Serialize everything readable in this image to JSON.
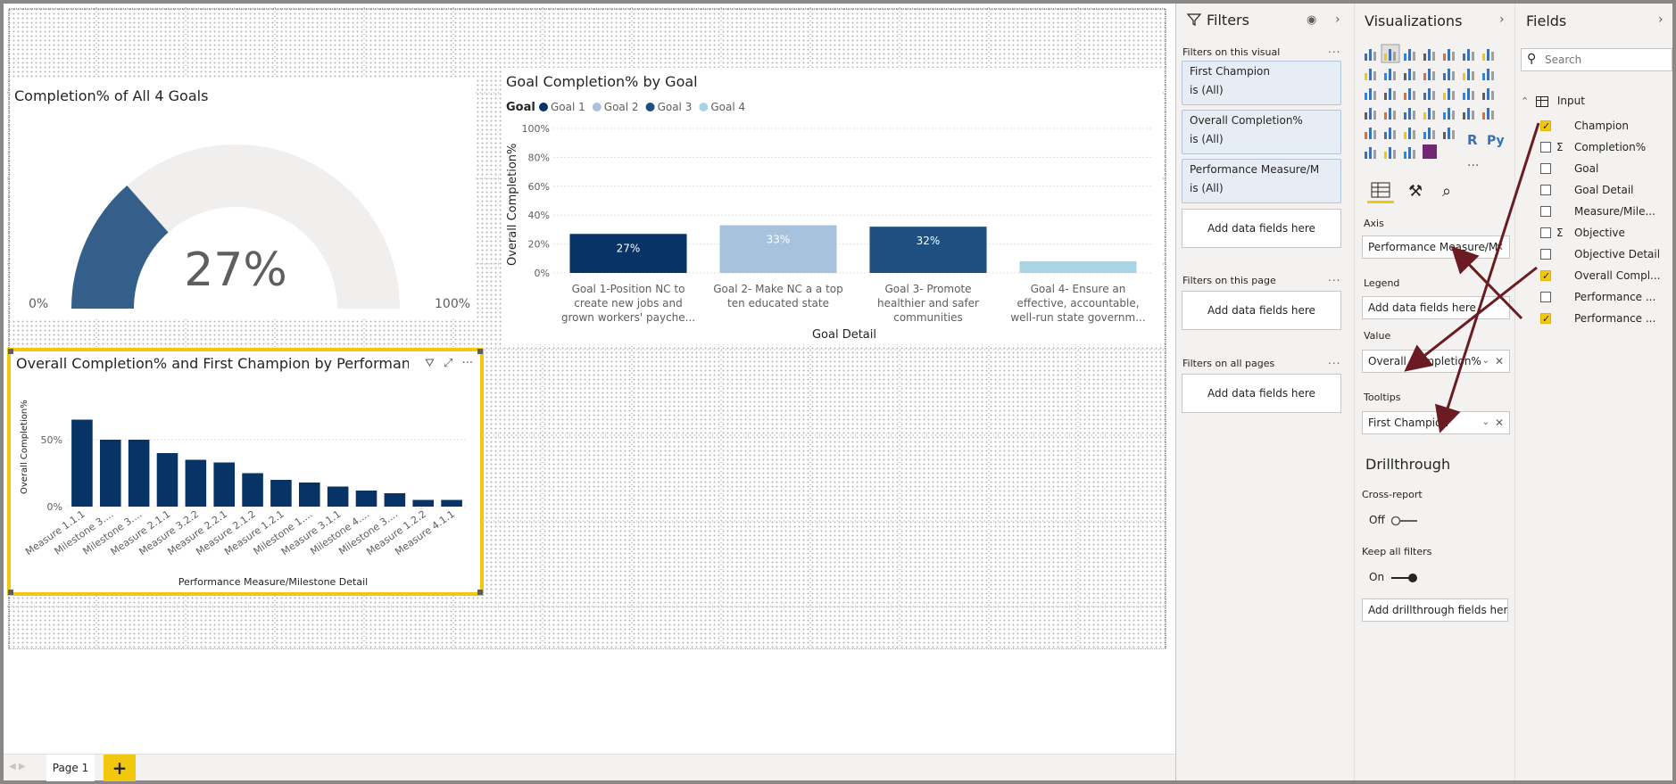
{
  "report": {
    "page_tab": "Page 1",
    "add_page": "+"
  },
  "gauge": {
    "title": "Completion% of All 4 Goals",
    "value_label": "27%",
    "min_label": "0%",
    "max_label": "100%",
    "value_fraction": 0.27,
    "fill_color": "#335f8a",
    "track_color": "#f0efee"
  },
  "goal_chart": {
    "title": "Goal Completion% by Goal",
    "legend_title": "Goal",
    "ylabel": "Overall Completion%",
    "xlabel": "Goal Detail",
    "yticks": [
      "100%",
      "80%",
      "60%",
      "40%",
      "20%",
      "0%"
    ]
  },
  "perf_chart": {
    "title": "Overall Completion% and First Champion by Performance Measure/Milestone Detail",
    "ylabel": "Overall Completion%",
    "xlabel": "Performance Measure/Milestone Detail",
    "yticks": [
      "50%",
      "0%"
    ]
  },
  "chart_data": [
    {
      "type": "bar",
      "title": "Goal Completion% by Goal",
      "xlabel": "Goal Detail",
      "ylabel": "Overall Completion%",
      "ylim": [
        0,
        100
      ],
      "legend_placement": "top-left",
      "categories": [
        [
          "Goal 1-Position NC to",
          "create new jobs and",
          "grown workers' payche..."
        ],
        [
          "Goal 2- Make NC a a top",
          "ten educated state"
        ],
        [
          "Goal 3- Promote",
          "healthier and safer",
          "communities"
        ],
        [
          "Goal 4- Ensure an",
          "effective, accountable,",
          "well-run state governm..."
        ]
      ],
      "series": [
        {
          "name": "Goal 1",
          "color": "#073366"
        },
        {
          "name": "Goal 2",
          "color": "#a7c2dc"
        },
        {
          "name": "Goal 3",
          "color": "#1f4e80"
        },
        {
          "name": "Goal 4",
          "color": "#a8d4e6"
        }
      ],
      "values": [
        27,
        33,
        32,
        8
      ],
      "data_labels": [
        "27%",
        "33%",
        "32%",
        ""
      ]
    },
    {
      "type": "bar",
      "title": "Overall Completion% and First Champion by Performance Measure/Milestone Detail",
      "xlabel": "Performance Measure/Milestone Detail",
      "ylabel": "Overall Completion%",
      "ylim": [
        0,
        80
      ],
      "color": "#073366",
      "categories": [
        "Measure 1.1.1",
        "Milestone 3....",
        "Milestone 3....",
        "Measure 2.1.1",
        "Measure 3.2.2",
        "Measure 2.2.1",
        "Measure 2.1.2",
        "Measure 1.2.1",
        "Milestone 1....",
        "Measure 3.1.1",
        "Milestone 4....",
        "Milestone 3....",
        "Measure 1.2.2",
        "Measure 4.1.1"
      ],
      "values": [
        65,
        50,
        50,
        40,
        35,
        33,
        25,
        20,
        18,
        15,
        12,
        10,
        5,
        5
      ]
    }
  ],
  "filters": {
    "title": "Filters",
    "on_visual": "Filters on this visual",
    "cards": [
      {
        "name": "First Champion",
        "state": "is (All)"
      },
      {
        "name": "Overall Completion%",
        "state": "is (All)"
      },
      {
        "name": "Performance Measure/M",
        "state": "is (All)"
      }
    ],
    "add_fields": "Add data fields here",
    "on_page": "Filters on this page",
    "on_all": "Filters on all pages",
    "dots": "..."
  },
  "viz": {
    "title": "Visualizations",
    "axis_label": "Axis",
    "axis_value": "Performance Measure/M",
    "legend_label": "Legend",
    "legend_value": "Add data fields here",
    "value_label": "Value",
    "value_value": "Overall Completion%",
    "tooltips_label": "Tooltips",
    "tooltips_value": "First Champion",
    "drill_title": "Drillthrough",
    "cross_report": "Cross-report",
    "off": "Off",
    "keep_filters": "Keep all filters",
    "on": "On",
    "add_drill": "Add drillthrough fields here",
    "r_label": "R",
    "py_label": "Py",
    "more": "..."
  },
  "fields": {
    "title": "Fields",
    "search_placeholder": "Search",
    "table_name": "Input",
    "items": [
      {
        "label": "Champion",
        "checked": true,
        "sigma": false
      },
      {
        "label": "Completion%",
        "checked": false,
        "sigma": true
      },
      {
        "label": "Goal",
        "checked": false,
        "sigma": false
      },
      {
        "label": "Goal Detail",
        "checked": false,
        "sigma": false
      },
      {
        "label": "Measure/Mile...",
        "checked": false,
        "sigma": false
      },
      {
        "label": "Objective",
        "checked": false,
        "sigma": true
      },
      {
        "label": "Objective Detail",
        "checked": false,
        "sigma": false
      },
      {
        "label": "Overall Compl...",
        "checked": true,
        "sigma": false
      },
      {
        "label": "Performance ...",
        "checked": false,
        "sigma": false
      },
      {
        "label": "Performance ...",
        "checked": true,
        "sigma": false
      }
    ]
  }
}
